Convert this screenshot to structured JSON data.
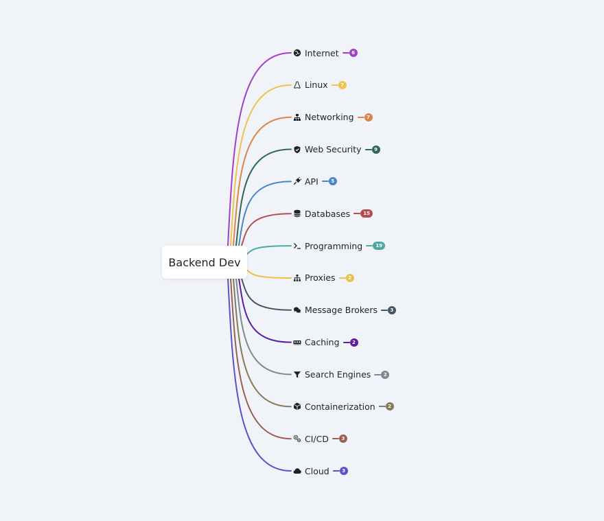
{
  "root": {
    "label": "Backend Dev"
  },
  "branches": [
    {
      "label": "Internet",
      "count": "6",
      "color": "#a23fc8",
      "icon": "globe-icon"
    },
    {
      "label": "Linux",
      "count": "7",
      "color": "#edc34d",
      "icon": "linux-icon"
    },
    {
      "label": "Networking",
      "count": "7",
      "color": "#db8548",
      "icon": "network-icon"
    },
    {
      "label": "Web Security",
      "count": "9",
      "color": "#2e6657",
      "icon": "shield-icon"
    },
    {
      "label": "API",
      "count": "5",
      "color": "#4a86c5",
      "icon": "plug-icon"
    },
    {
      "label": "Databases",
      "count": "15",
      "color": "#b54c52",
      "icon": "database-icon"
    },
    {
      "label": "Programming",
      "count": "19",
      "color": "#4ea8a0",
      "icon": "terminal-icon"
    },
    {
      "label": "Proxies",
      "count": "2",
      "color": "#eec04a",
      "icon": "sitemap-icon"
    },
    {
      "label": "Message Brokers",
      "count": "3",
      "color": "#465566",
      "icon": "chat-icon"
    },
    {
      "label": "Caching",
      "count": "2",
      "color": "#5e1ca0",
      "icon": "memory-icon"
    },
    {
      "label": "Search Engines",
      "count": "2",
      "color": "#7b8896",
      "icon": "filter-icon"
    },
    {
      "label": "Containerization",
      "count": "2",
      "color": "#86785a",
      "icon": "cube-icon"
    },
    {
      "label": "CI/CD",
      "count": "3",
      "color": "#9c5e51",
      "icon": "gears-icon"
    },
    {
      "label": "Cloud",
      "count": "3",
      "color": "#5d4fc7",
      "icon": "cloud-icon"
    }
  ]
}
